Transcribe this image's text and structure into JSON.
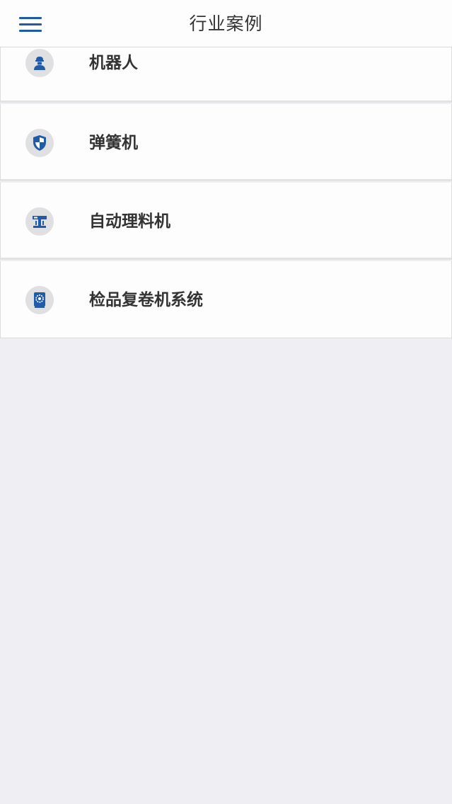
{
  "header": {
    "title": "行业案例",
    "menu_icon": "hamburger-menu-icon"
  },
  "list": {
    "items": [
      {
        "label": "机器人",
        "icon": "robot-worker-icon"
      },
      {
        "label": "弹簧机",
        "icon": "shield-icon"
      },
      {
        "label": "自动理料机",
        "icon": "machine-icon"
      },
      {
        "label": "检品复卷机系统",
        "icon": "gear-book-icon"
      }
    ]
  },
  "colors": {
    "accent": "#1f5ba8",
    "background": "#efeef2",
    "card": "#fdfdfd",
    "text": "#333333",
    "icon_bg": "#e0e0e3"
  }
}
